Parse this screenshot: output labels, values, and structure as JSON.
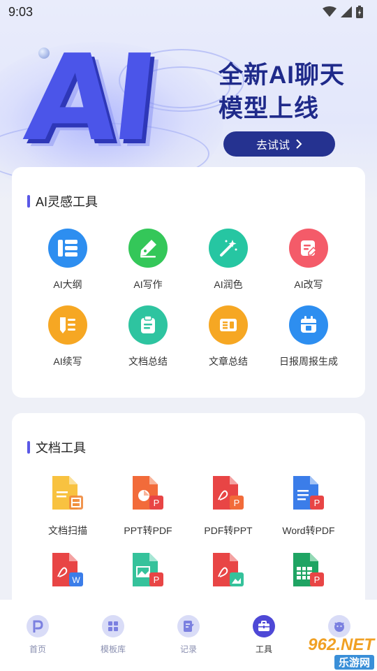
{
  "status": {
    "time": "9:03"
  },
  "banner": {
    "logo_text": "AI",
    "title_line1": "全新AI聊天",
    "title_line2": "模型上线",
    "button_label": "去试试"
  },
  "ai_tools": {
    "title": "AI灵感工具",
    "items": [
      {
        "label": "AI大纲",
        "icon": "outline-icon",
        "color": "#2d8ef0"
      },
      {
        "label": "AI写作",
        "icon": "pen-icon",
        "color": "#34c759"
      },
      {
        "label": "AI润色",
        "icon": "magic-wand-icon",
        "color": "#26c6a2"
      },
      {
        "label": "AI改写",
        "icon": "edit-doc-icon",
        "color": "#f45b69"
      },
      {
        "label": "AI续写",
        "icon": "continue-write-icon",
        "color": "#f6a723"
      },
      {
        "label": "文档总结",
        "icon": "clipboard-icon",
        "color": "#2ec4a0"
      },
      {
        "label": "文章总结",
        "icon": "article-icon",
        "color": "#f6a723"
      },
      {
        "label": "日报周报生成",
        "icon": "calendar-icon",
        "color": "#2d8ef0"
      }
    ]
  },
  "doc_tools": {
    "title": "文档工具",
    "items": [
      {
        "label": "文档扫描",
        "icon": "doc-scan-icon",
        "color": "#f6b73c"
      },
      {
        "label": "PPT转PDF",
        "icon": "ppt-to-pdf-icon",
        "color": "#f26b3a"
      },
      {
        "label": "PDF转PPT",
        "icon": "pdf-to-ppt-icon",
        "color": "#e84545"
      },
      {
        "label": "Word转PDF",
        "icon": "word-to-pdf-icon",
        "color": "#3b7de9"
      },
      {
        "label": "",
        "icon": "pdf-to-word-icon",
        "color": "#e84545"
      },
      {
        "label": "",
        "icon": "image-to-pdf-icon",
        "color": "#35c29b"
      },
      {
        "label": "",
        "icon": "pdf-to-image-icon",
        "color": "#e84545"
      },
      {
        "label": "",
        "icon": "excel-to-pdf-icon",
        "color": "#1fa463"
      }
    ]
  },
  "tabbar": {
    "items": [
      {
        "label": "首页",
        "icon": "home-p-icon"
      },
      {
        "label": "模板库",
        "icon": "grid-icon"
      },
      {
        "label": "记录",
        "icon": "record-icon"
      },
      {
        "label": "工具",
        "icon": "toolbox-icon",
        "active": true
      },
      {
        "label": "",
        "icon": "profile-icon"
      }
    ]
  },
  "watermark": {
    "line1": "962.NET",
    "line2": "乐游网"
  }
}
